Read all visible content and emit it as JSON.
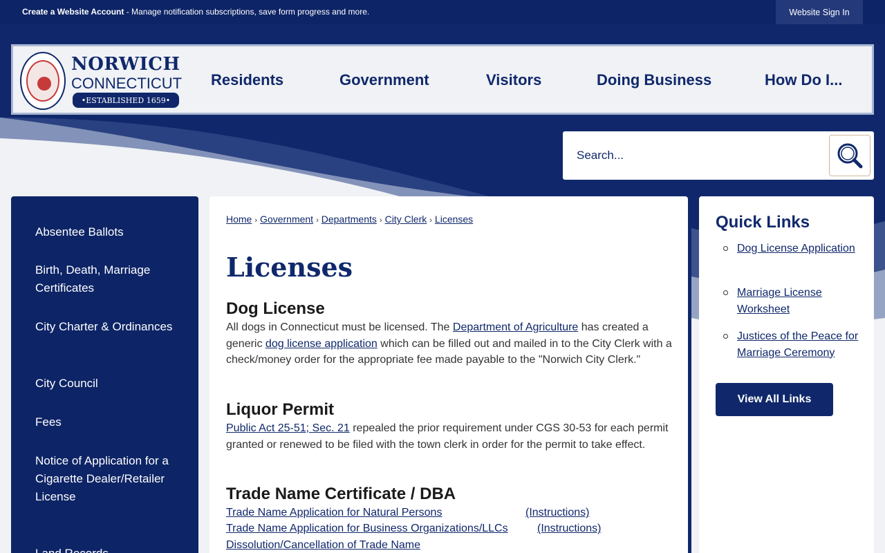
{
  "topbar": {
    "create_account": "Create a Website Account",
    "create_account_rest": " - Manage notification subscriptions, save form progress and more.",
    "sign_in": "Website Sign In"
  },
  "logo": {
    "line1": "NORWICH",
    "line2": "CONNECTICUT",
    "line3": "•ESTABLISHED 1659•"
  },
  "nav": [
    "Residents",
    "Government",
    "Visitors",
    "Doing Business",
    "How Do I..."
  ],
  "search": {
    "placeholder": "Search..."
  },
  "sidebar": {
    "items": [
      "Absentee Ballots",
      "Birth, Death, Marriage Certificates",
      "City Charter & Ordinances",
      "City Council",
      "Fees",
      "Notice of Application for a Cigarette Dealer/Retailer License",
      "Land Records"
    ]
  },
  "breadcrumb": [
    "Home",
    "Government",
    "Departments",
    "City Clerk",
    "Licenses"
  ],
  "main": {
    "title": "Licenses",
    "dog": {
      "heading": "Dog License",
      "t1": "All dogs in Connecticut must be licensed. The ",
      "link1": "Department of Agriculture",
      "t2": " has created a generic ",
      "link2": "dog license application",
      "t3": " which can be filled out and mailed in to the City Clerk with a check/money order for the appropriate fee made payable to the \"Norwich City Clerk.\""
    },
    "liquor": {
      "heading": "Liquor Permit",
      "link": "Public Act 25-51; Sec. 21",
      "text": " repealed the prior requirement under CGS 30-53 for each permit granted or renewed to be filed with the town clerk in order for the permit to take effect."
    },
    "trade": {
      "heading": "Trade Name Certificate / DBA",
      "link1": "Trade Name Application for Natural Persons",
      "instr1": "(Instructions)",
      "link2": "Trade Name Application for Business Organizations/LLCs",
      "instr2": "(Instructions)",
      "link3": "Dissolution/Cancellation of Trade Name"
    }
  },
  "quick_links": {
    "title": "Quick Links",
    "items": [
      "Dog License Application",
      "Marriage License Worksheet",
      "Justices of the Peace for Marriage Ceremony"
    ],
    "view_all": "View All Links"
  },
  "colors": {
    "navy": "#10286b",
    "background": "#10286b",
    "panel": "#ffffff"
  }
}
